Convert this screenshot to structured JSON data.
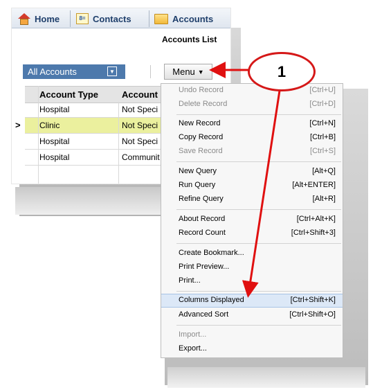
{
  "tabs": [
    {
      "label": "Home",
      "icon": "home-icon"
    },
    {
      "label": "Contacts",
      "icon": "contacts-icon"
    },
    {
      "label": "Accounts",
      "icon": "accounts-folder-icon"
    }
  ],
  "list_title": "Accounts List",
  "filter": {
    "label": "All Accounts"
  },
  "menu_button": {
    "label": "Menu"
  },
  "grid": {
    "columns": [
      "Account Type",
      "Account"
    ],
    "rows": [
      [
        "Hospital",
        "Not Speci"
      ],
      [
        "Clinic",
        "Not Speci"
      ],
      [
        "Hospital",
        "Not Speci"
      ],
      [
        "Hospital",
        "Communit"
      ]
    ],
    "selected_row": 1
  },
  "menu": {
    "items": [
      {
        "label": "Undo Record",
        "shortcut": "[Ctrl+U]"
      },
      {
        "label": "Delete Record",
        "shortcut": "[Ctrl+D]"
      },
      {
        "label": "New Record",
        "shortcut": "[Ctrl+N]"
      },
      {
        "label": "Copy Record",
        "shortcut": "[Ctrl+B]"
      },
      {
        "label": "Save Record",
        "shortcut": "[Ctrl+S]"
      },
      {
        "label": "New Query",
        "shortcut": "[Alt+Q]"
      },
      {
        "label": "Run Query",
        "shortcut": "[Alt+ENTER]"
      },
      {
        "label": "Refine Query",
        "shortcut": "[Alt+R]"
      },
      {
        "label": "About Record",
        "shortcut": "[Ctrl+Alt+K]"
      },
      {
        "label": "Record Count",
        "shortcut": "[Ctrl+Shift+3]"
      },
      {
        "label": "Create Bookmark...",
        "shortcut": ""
      },
      {
        "label": "Print Preview...",
        "shortcut": ""
      },
      {
        "label": "Print...",
        "shortcut": ""
      },
      {
        "label": "Columns Displayed",
        "shortcut": "[Ctrl+Shift+K]"
      },
      {
        "label": "Advanced Sort",
        "shortcut": "[Ctrl+Shift+O]"
      },
      {
        "label": "Import...",
        "shortcut": ""
      },
      {
        "label": "Export...",
        "shortcut": ""
      }
    ]
  },
  "callout": {
    "number": "1"
  },
  "colors": {
    "callout_border": "#d51818",
    "arrow": "#e01010",
    "filter_bg": "#4d79ac",
    "selected_row": "#ebf09e",
    "highlight": "#dce8f7"
  }
}
